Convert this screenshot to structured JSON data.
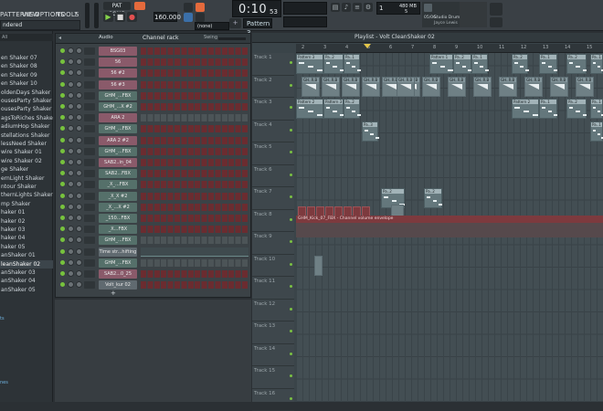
{
  "menu": {
    "items": [
      "PATTERNS",
      "VIEW",
      "OPTIONS",
      "TOOLS",
      "?"
    ]
  },
  "toolbar": {
    "tempo": "160.000",
    "time": "0:10",
    "time_small": "53",
    "time_sub": "M:S:CS",
    "pattern": "Pattern 3",
    "snap": "(none)",
    "cpu": "1",
    "mem": "480 MB",
    "poly": "5",
    "hint_time": "05/06",
    "hint_title": "Studio Drum Tracks |",
    "hint_author": "Jayce Lewis"
  },
  "browser": {
    "title": "ndered",
    "filter": "All",
    "items": [
      "en Shaker 07",
      "en Shaker 08",
      "en Shaker 09",
      "en Shaker 10",
      "oldenDays Shaker",
      "ousesParty Shaker 01",
      "ousesParty Shaker 02",
      "agsToRiches Shaker",
      "adiumHop Shaker",
      "stellations Shaker",
      "lessNeed Shaker",
      "wire Shaker 01",
      "wire Shaker 02",
      "ge Shaker",
      "ernLight Shaker",
      "ntour Shaker",
      "thernLights Shaker",
      "mp Shaker",
      "haker 01",
      "haker 02",
      "haker 03",
      "haker 04",
      "haker 05",
      "anShaker 01",
      "leanShaker 02",
      "anShaker 03",
      "anShaker 04",
      "anShaker 05"
    ],
    "selected_index": 24,
    "side_labels": [
      "ts",
      "nes"
    ]
  },
  "rack": {
    "title": "Channel rack",
    "group": "Audio",
    "swing": "Swing",
    "add": "+",
    "channels": [
      {
        "name": "BSG03",
        "color": "pink",
        "steps": "red"
      },
      {
        "name": "56",
        "color": "pink",
        "steps": "red"
      },
      {
        "name": "56 #2",
        "color": "pink",
        "steps": "red"
      },
      {
        "name": "56 #3",
        "color": "pink",
        "steps": "red"
      },
      {
        "name": "GHM_...FBX",
        "color": "grn",
        "steps": "red"
      },
      {
        "name": "GHM_...X #2",
        "color": "grn",
        "steps": "red"
      },
      {
        "name": "ARA 2",
        "color": "pink",
        "steps": "gray"
      },
      {
        "name": "GHM_...FBX",
        "color": "grn",
        "steps": "red"
      },
      {
        "name": "ARA 2 #2",
        "color": "pink",
        "steps": "red"
      },
      {
        "name": "GHM_...FBX",
        "color": "grn",
        "steps": "red"
      },
      {
        "name": "SAB2..in_04",
        "color": "pink",
        "steps": "red"
      },
      {
        "name": "SAB2...FBX",
        "color": "grn",
        "steps": "red"
      },
      {
        "name": "_X_...FBX",
        "color": "grn",
        "steps": "red"
      },
      {
        "name": "_X_X #2",
        "color": "grn",
        "steps": "red"
      },
      {
        "name": "_X_...X #2",
        "color": "grn",
        "steps": "red"
      },
      {
        "name": "_150...FBX",
        "color": "grn",
        "steps": "red"
      },
      {
        "name": "_X...FBX",
        "color": "grn",
        "steps": "red"
      },
      {
        "name": "GHM_...FBX",
        "color": "grn",
        "steps": "gray"
      },
      {
        "name": "Time str...hifting",
        "color": "gry",
        "steps": "none"
      },
      {
        "name": "GHM_...FBX",
        "color": "grn",
        "steps": "gray"
      },
      {
        "name": "SAB2...0_25",
        "color": "pink",
        "steps": "red"
      },
      {
        "name": "Volt_kur 02",
        "color": "gry",
        "steps": "red"
      }
    ]
  },
  "playlist": {
    "title": "Playlist - Volt CleanShaker 02",
    "bars": [
      "2",
      "3",
      "4",
      "5",
      "6",
      "7",
      "8",
      "9",
      "10",
      "11",
      "12",
      "13",
      "14",
      "15"
    ],
    "tracks": [
      "Track 1",
      "Track 2",
      "Track 3",
      "Track 4",
      "Track 5",
      "Track 6",
      "Track 7",
      "Track 8",
      "Track 9",
      "Track 10",
      "Track 11",
      "Track 12",
      "Track 13",
      "Track 14",
      "Track 15",
      "Track 16"
    ],
    "automation_label": "GHM_Kick_07_FBX - Channel volume envelope",
    "pattern_labels": [
      "Pattern 3",
      "Pa..2",
      "Pa..1",
      "Pattern 1",
      "Pa..2",
      "Pa..1",
      "Pa..2",
      "Pattern 2",
      "Pattern 3",
      "Pa..2",
      "Pattern 2",
      "Pa..1",
      "Pa..2",
      "Pa..1",
      "Pa..3",
      "Pattern 3",
      "Pa..2",
      "Pa..1",
      "Pa..2",
      "Pa..1",
      "Pa..3"
    ],
    "audio_label": "GH..R.B"
  },
  "colors": {
    "accent": "#77c23d",
    "step_red": "#6b2c30",
    "clip": "#6f8085",
    "automation": "#7d3a3e"
  }
}
